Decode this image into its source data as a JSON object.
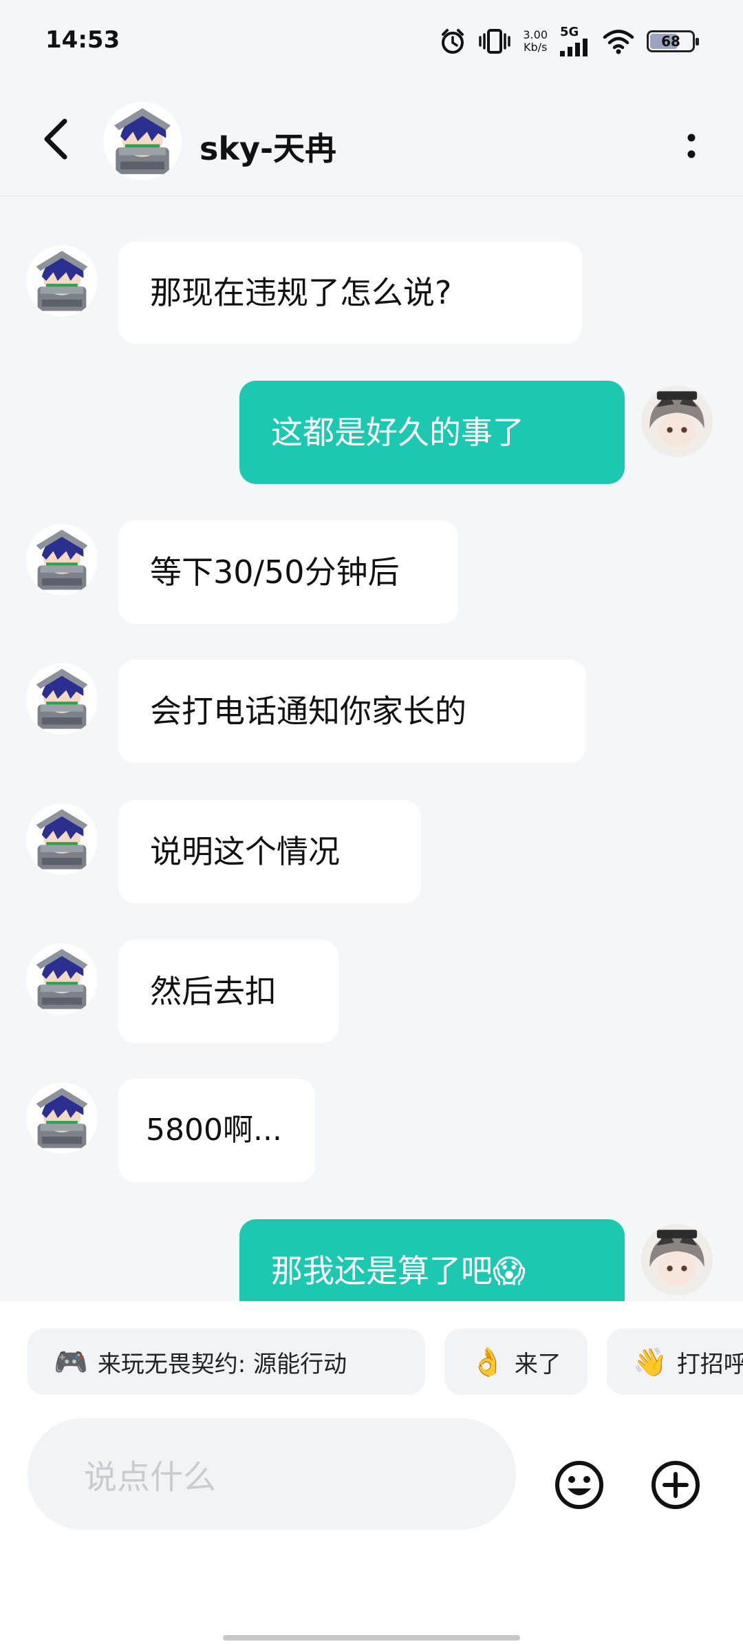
{
  "status_bar": {
    "time": "14:53",
    "net_speed_value": "3.00",
    "net_speed_unit": "Kb/s",
    "network": "5G",
    "battery": "68",
    "battery_level": 0.68,
    "icons": [
      "alarm-icon",
      "vibrate-icon",
      "signal-icon",
      "wifi-icon",
      "battery-icon"
    ]
  },
  "header": {
    "contact_name": "sky-天冉",
    "icons": [
      "back-arrow-icon",
      "more-vertical-icon"
    ]
  },
  "messages": [
    {
      "side": "in",
      "text": "那现在违规了怎么说?"
    },
    {
      "side": "out",
      "text": "这都是好久的事了"
    },
    {
      "side": "in",
      "text": "等下30/50分钟后"
    },
    {
      "side": "in",
      "text": "会打电话通知你家长的"
    },
    {
      "side": "in",
      "text": "说明这个情况"
    },
    {
      "side": "in",
      "text": "然后去扣"
    },
    {
      "side": "in",
      "text": "5800啊..."
    },
    {
      "side": "out",
      "text": "那我还是算了吧😱"
    }
  ],
  "quick_replies": [
    {
      "emoji": "🎮",
      "text": "来玩无畏契约: 源能行动"
    },
    {
      "emoji": "👌",
      "text": "来了"
    },
    {
      "emoji": "👋",
      "text": "打招呼"
    }
  ],
  "input": {
    "placeholder": "说点什么",
    "icons": [
      "emoji-icon",
      "plus-icon"
    ]
  },
  "colors": {
    "outgoing_bubble": "#1cc8b0",
    "incoming_bubble": "#ffffff",
    "background": "#f5f6f8"
  }
}
